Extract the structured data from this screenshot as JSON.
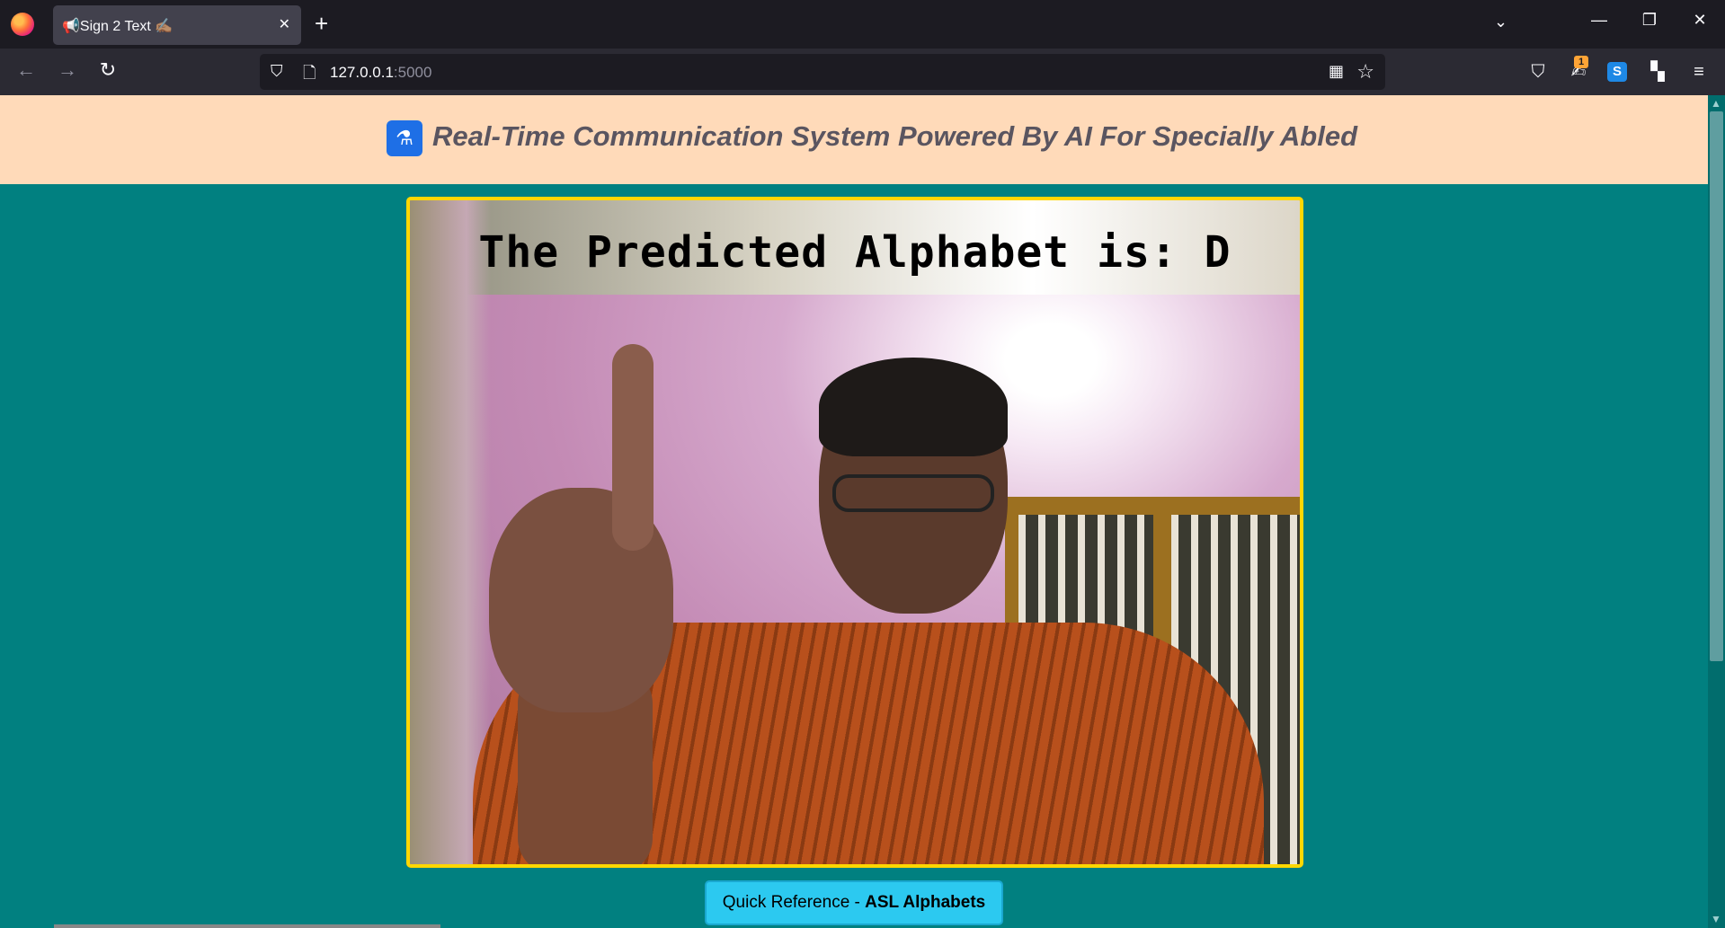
{
  "browser": {
    "tab_title": "📢Sign 2 Text ✍🏽",
    "tab_close": "✕",
    "new_tab": "+",
    "url_host": "127.0.0.1",
    "url_port": ":5000"
  },
  "header": {
    "logo_icon": "flask-icon",
    "title": "Real-Time Communication System Powered By AI For Specially Abled"
  },
  "video": {
    "prediction_text": "The Predicted Alphabet is: D"
  },
  "reference_button": {
    "prefix": "Quick Reference - ",
    "bold": "ASL Alphabets"
  },
  "extensions": {
    "badge": "1"
  },
  "colors": {
    "page_bg": "#018080",
    "header_bg": "#ffdab9",
    "frame_border": "#ffd700",
    "button_bg": "#2cc9f0"
  }
}
